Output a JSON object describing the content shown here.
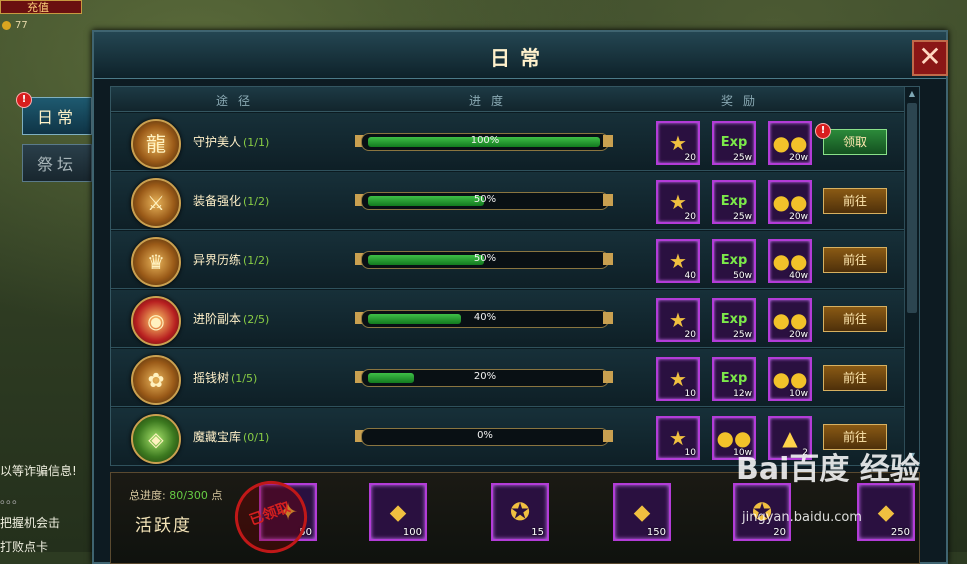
{
  "hud": {
    "top_button": "充值",
    "coin_count": "77"
  },
  "side_texts": [
    "以等诈骗信息!",
    "。。。",
    "把握机会击",
    "打败点卡"
  ],
  "tabs": [
    {
      "label": "日常",
      "active": true
    },
    {
      "label": "祭坛",
      "active": false
    }
  ],
  "panel": {
    "title": "日常",
    "close": "✕"
  },
  "columns": {
    "route": "途径",
    "progress": "进度",
    "reward": "奖励"
  },
  "tasks": [
    {
      "name": "守护美人",
      "count": "(1/1)",
      "progress": 100,
      "progress_text": "100%",
      "icon": "dragon-crest-icon",
      "rewards": [
        {
          "type": "star",
          "qty": "20"
        },
        {
          "type": "exp",
          "qty": "25w"
        },
        {
          "type": "coin",
          "qty": "20w"
        }
      ],
      "action": "领取",
      "claimable": true
    },
    {
      "name": "装备强化",
      "count": "(1/2)",
      "progress": 50,
      "progress_text": "50%",
      "icon": "crossed-swords-icon",
      "rewards": [
        {
          "type": "star",
          "qty": "20"
        },
        {
          "type": "exp",
          "qty": "25w"
        },
        {
          "type": "coin",
          "qty": "20w"
        }
      ],
      "action": "前往",
      "claimable": false
    },
    {
      "name": "异界历练",
      "count": "(1/2)",
      "progress": 50,
      "progress_text": "50%",
      "icon": "beast-head-icon",
      "rewards": [
        {
          "type": "star",
          "qty": "40"
        },
        {
          "type": "exp",
          "qty": "50w"
        },
        {
          "type": "coin",
          "qty": "40w"
        }
      ],
      "action": "前往",
      "claimable": false
    },
    {
      "name": "进阶副本",
      "count": "(2/5)",
      "progress": 40,
      "progress_text": "40%",
      "icon": "red-shield-icon",
      "rewards": [
        {
          "type": "star",
          "qty": "20"
        },
        {
          "type": "exp",
          "qty": "25w"
        },
        {
          "type": "coin",
          "qty": "20w"
        }
      ],
      "action": "前往",
      "claimable": false
    },
    {
      "name": "摇钱树",
      "count": "(1/5)",
      "progress": 20,
      "progress_text": "20%",
      "icon": "money-tree-icon",
      "rewards": [
        {
          "type": "star",
          "qty": "10"
        },
        {
          "type": "exp",
          "qty": "12w"
        },
        {
          "type": "coin",
          "qty": "10w"
        }
      ],
      "action": "前往",
      "claimable": false
    },
    {
      "name": "魔藏宝库",
      "count": "(0/1)",
      "progress": 0,
      "progress_text": "0%",
      "icon": "treasure-vault-icon",
      "rewards": [
        {
          "type": "star",
          "qty": "10"
        },
        {
          "type": "coin",
          "qty": "10w"
        },
        {
          "type": "tower",
          "qty": "2"
        }
      ],
      "action": "前往",
      "claimable": false
    }
  ],
  "activity": {
    "total_label": "总进度:",
    "total_value": "80/300",
    "total_unit": "点",
    "title": "活跃度",
    "stamp": "已领取",
    "chests": [
      {
        "qty": "50"
      },
      {
        "qty": "100"
      },
      {
        "qty": "15"
      },
      {
        "qty": "150"
      },
      {
        "qty": "20"
      },
      {
        "qty": "250"
      }
    ]
  },
  "watermark": {
    "brand": "Bai百度 经验",
    "url": "jingyan.baidu.com"
  }
}
